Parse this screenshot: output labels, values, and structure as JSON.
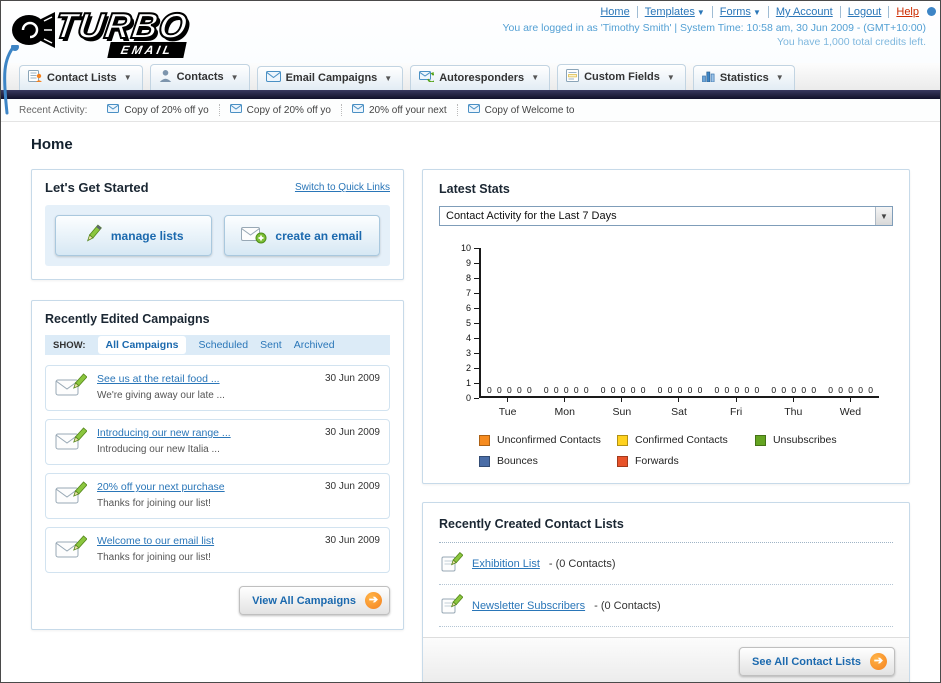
{
  "header": {
    "logo_primary": "TURBO",
    "logo_secondary": "EMAIL",
    "links": [
      {
        "label": "Home",
        "dropdown": false
      },
      {
        "label": "Templates",
        "dropdown": true
      },
      {
        "label": "Forms",
        "dropdown": true
      },
      {
        "label": "My Account",
        "dropdown": false
      },
      {
        "label": "Logout",
        "dropdown": false
      },
      {
        "label": "Help",
        "dropdown": false
      }
    ],
    "status_line": "You are logged in as 'Timothy Smith' | System Time: 10:58 am, 30 Jun 2009 - (GMT+10:00)",
    "credits_line": "You have 1,000 total credits left."
  },
  "nav": {
    "tabs": [
      {
        "label": "Contact Lists"
      },
      {
        "label": "Contacts"
      },
      {
        "label": "Email Campaigns"
      },
      {
        "label": "Autoresponders"
      },
      {
        "label": "Custom Fields"
      },
      {
        "label": "Statistics"
      }
    ]
  },
  "recent_activity": {
    "label": "Recent Activity:",
    "items": [
      {
        "label": "Copy of 20% off yo"
      },
      {
        "label": "Copy of 20% off yo"
      },
      {
        "label": "20% off your next"
      },
      {
        "label": "Copy of Welcome to"
      }
    ]
  },
  "page": {
    "title": "Home"
  },
  "get_started": {
    "title": "Let's Get Started",
    "switch_link": "Switch to Quick Links",
    "manage_lists_label": "manage lists",
    "create_email_label": "create an email"
  },
  "campaigns": {
    "title": "Recently Edited Campaigns",
    "show_label": "SHOW:",
    "filters": [
      {
        "label": "All Campaigns",
        "active": true
      },
      {
        "label": "Scheduled",
        "active": false
      },
      {
        "label": "Sent",
        "active": false
      },
      {
        "label": "Archived",
        "active": false
      }
    ],
    "items": [
      {
        "title": "See us at the retail food ...",
        "subtitle": "We're giving away our late ...",
        "date": "30 Jun 2009"
      },
      {
        "title": "Introducing our new range ...",
        "subtitle": "Introducing our new Italia ...",
        "date": "30 Jun 2009"
      },
      {
        "title": "20% off your next purchase",
        "subtitle": "Thanks for joining our list!",
        "date": "30 Jun 2009"
      },
      {
        "title": "Welcome to our email list",
        "subtitle": "Thanks for joining our list!",
        "date": "30 Jun 2009"
      }
    ],
    "view_all_label": "View All Campaigns"
  },
  "latest_stats": {
    "title": "Latest Stats",
    "selector_value": "Contact Activity for the Last 7 Days",
    "chart_data": {
      "type": "bar",
      "title": "Contact Activity for the Last 7 Days",
      "categories": [
        "Tue",
        "Mon",
        "Sun",
        "Sat",
        "Fri",
        "Thu",
        "Wed"
      ],
      "series": [
        {
          "name": "Unconfirmed Contacts",
          "color": "#f68b1f",
          "values": [
            0,
            0,
            0,
            0,
            0,
            0,
            0
          ]
        },
        {
          "name": "Confirmed Contacts",
          "color": "#ffd21f",
          "values": [
            0,
            0,
            0,
            0,
            0,
            0,
            0
          ]
        },
        {
          "name": "Unsubscribes",
          "color": "#64a421",
          "values": [
            0,
            0,
            0,
            0,
            0,
            0,
            0
          ]
        },
        {
          "name": "Bounces",
          "color": "#4a6da7",
          "values": [
            0,
            0,
            0,
            0,
            0,
            0,
            0
          ]
        },
        {
          "name": "Forwards",
          "color": "#e8532a",
          "values": [
            0,
            0,
            0,
            0,
            0,
            0,
            0
          ]
        }
      ],
      "ylim": [
        0,
        10
      ],
      "ytick_step": 1,
      "grid": false,
      "legend_position": "bottom",
      "xlabel": "",
      "ylabel": ""
    }
  },
  "contact_lists": {
    "title": "Recently Created Contact Lists",
    "items": [
      {
        "name": "Exhibition List",
        "suffix": "- (0 Contacts)"
      },
      {
        "name": "Newsletter Subscribers",
        "suffix": "- (0 Contacts)"
      }
    ],
    "see_all_label": "See All Contact Lists"
  }
}
